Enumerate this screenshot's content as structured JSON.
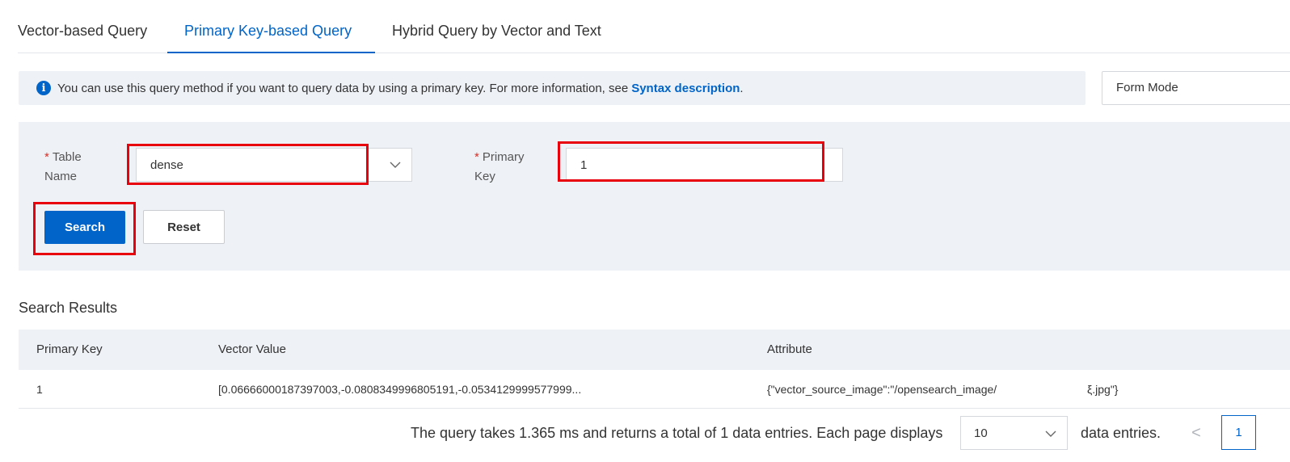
{
  "tabs": [
    {
      "label": "Vector-based Query"
    },
    {
      "label": "Primary Key-based Query"
    },
    {
      "label": "Hybrid Query by Vector and Text"
    }
  ],
  "active_tab": "Primary Key-based Query",
  "info": {
    "text": "You can use this query method if you want to query data by using a primary key. For more information, see",
    "link": "Syntax description",
    "suffix": "."
  },
  "mode_select": {
    "value": "Form Mode"
  },
  "form": {
    "table_label": "Table Name",
    "table_value": "dense",
    "pk_label": "Primary Key",
    "pk_value": "1",
    "required_mark": "*",
    "search_label": "Search",
    "reset_label": "Reset"
  },
  "results": {
    "title": "Search Results",
    "columns": [
      "Primary Key",
      "Vector Value",
      "Attribute"
    ],
    "rows": [
      {
        "primary_key": "1",
        "vector_value": "[0.06666000187397003,-0.0808349996805191,-0.0534129999577999...",
        "attribute": "{\"vector_source_image\":\"/opensearch_image/",
        "attribute_tail": "ξ.jpg\"}"
      }
    ]
  },
  "pagination": {
    "summary": "The query takes 1.365 ms and returns a total of 1 data entries. Each page displays",
    "page_size": "10",
    "suffix": "data entries.",
    "prev": "<",
    "current_page": "1"
  },
  "colors": {
    "primary": "#0064c8",
    "highlight": "#e8000d",
    "panel": "#eef1f6"
  }
}
